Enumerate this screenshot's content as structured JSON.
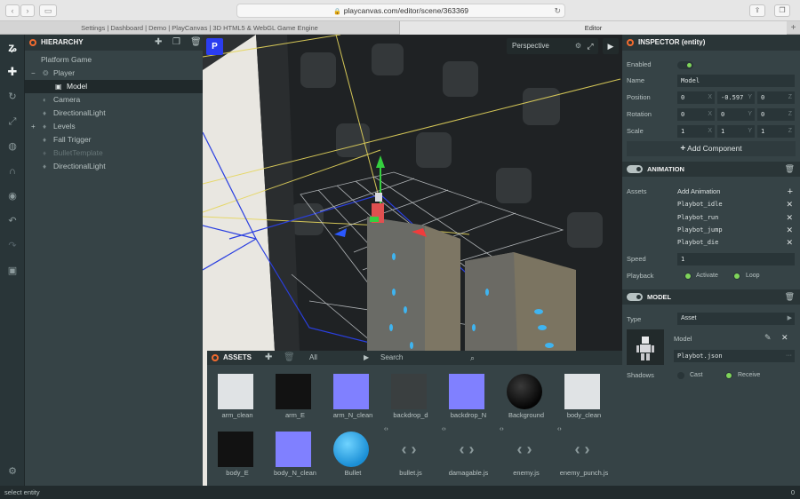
{
  "browser": {
    "url": "playcanvas.com/editor/scene/363369",
    "tabs": [
      {
        "label": "Settings | Dashboard | Demo | PlayCanvas | 3D HTML5 & WebGL Game Engine"
      },
      {
        "label": "Editor"
      }
    ]
  },
  "hierarchy": {
    "title": "HIERARCHY",
    "items": [
      {
        "label": "Platform Game"
      },
      {
        "label": "Player"
      },
      {
        "label": "Model"
      },
      {
        "label": "Camera"
      },
      {
        "label": "DirectionalLight"
      },
      {
        "label": "Levels"
      },
      {
        "label": "Fall Trigger"
      },
      {
        "label": "BulletTemplate"
      },
      {
        "label": "DirectionalLight"
      }
    ]
  },
  "viewport": {
    "camera": "Perspective"
  },
  "assets": {
    "title": "ASSETS",
    "filter": "All",
    "search_placeholder": "Search",
    "items": [
      {
        "label": "arm_clean",
        "kind": "texture-light"
      },
      {
        "label": "arm_E",
        "kind": "texture-dark"
      },
      {
        "label": "arm_N_clean",
        "kind": "texture-normal"
      },
      {
        "label": "backdrop_d",
        "kind": "texture-mid"
      },
      {
        "label": "backdrop_N",
        "kind": "texture-normal"
      },
      {
        "label": "Background",
        "kind": "material-black"
      },
      {
        "label": "body_clean",
        "kind": "texture-light"
      },
      {
        "label": "body_E",
        "kind": "texture-dark"
      },
      {
        "label": "body_N_clean",
        "kind": "texture-normal"
      },
      {
        "label": "Bullet",
        "kind": "material-blue"
      },
      {
        "label": "bullet.js",
        "kind": "script"
      },
      {
        "label": "damagable.js",
        "kind": "script"
      },
      {
        "label": "enemy.js",
        "kind": "script"
      },
      {
        "label": "enemy_punch.js",
        "kind": "script"
      }
    ]
  },
  "inspector": {
    "title": "INSPECTOR (entity)",
    "enabled_label": "Enabled",
    "name_label": "Name",
    "name_value": "Model",
    "position_label": "Position",
    "position": [
      "0",
      "-0.597",
      "0"
    ],
    "rotation_label": "Rotation",
    "rotation": [
      "0",
      "0",
      "0"
    ],
    "scale_label": "Scale",
    "scale": [
      "1",
      "1",
      "1"
    ],
    "axes": [
      "X",
      "Y",
      "Z"
    ],
    "add_component": "Add Component",
    "animation": {
      "title": "ANIMATION",
      "assets_label": "Assets",
      "add_label": "Add Animation",
      "clips": [
        "Playbot_idle",
        "Playbot_run",
        "Playbot_jump",
        "Playbot_die"
      ],
      "speed_label": "Speed",
      "speed_value": "1",
      "playback_label": "Playback",
      "activate_label": "Activate",
      "loop_label": "Loop"
    },
    "model": {
      "title": "MODEL",
      "type_label": "Type",
      "type_value": "Asset",
      "model_label": "Model",
      "model_file": "Playbot.json",
      "shadows_label": "Shadows",
      "cast_label": "Cast",
      "receive_label": "Receive"
    }
  },
  "status": {
    "left": "select entity",
    "right": "0"
  },
  "colors": {
    "accent": "#f16b2f",
    "toggle_on": "#7fd45a",
    "panel": "#364346",
    "dark_panel": "#293538"
  }
}
